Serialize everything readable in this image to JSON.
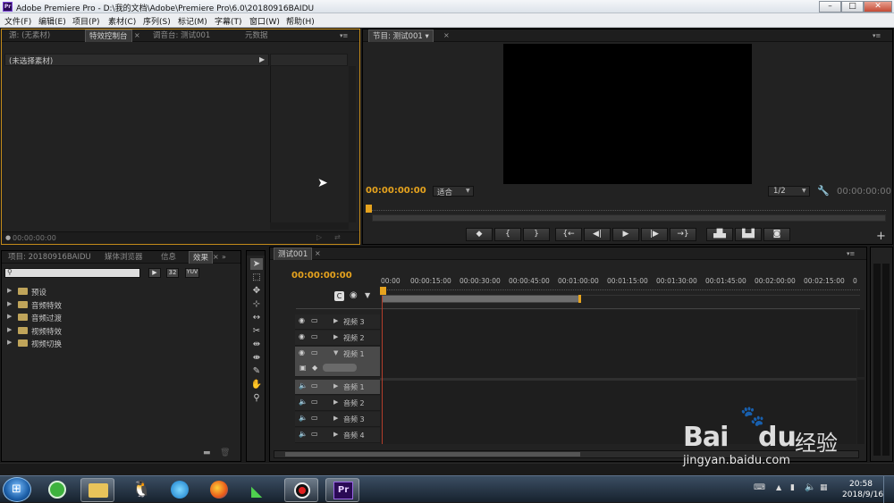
{
  "app": {
    "title": "Adobe Premiere Pro - D:\\我的文档\\Adobe\\Premiere Pro\\6.0\\20180916BAIDU",
    "logo": "Pr"
  },
  "menu": [
    "文件(F)",
    "编辑(E)",
    "项目(P)",
    "素材(C)",
    "序列(S)",
    "标记(M)",
    "字幕(T)",
    "窗口(W)",
    "帮助(H)"
  ],
  "source_panel": {
    "tabs": [
      "源: (无素材)",
      "特效控制台",
      "调音台: 测试001",
      "元数据"
    ],
    "no_clip": "(未选择素材)",
    "footer_tc": "00:00:00:00"
  },
  "program": {
    "tab": "节目: 测试001",
    "timecode": "00:00:00:00",
    "fit": "适合",
    "quality": "1/2",
    "duration": "00:00:00:00"
  },
  "project_panel": {
    "tabs": [
      "项目: 20180916BAIDU",
      "媒体浏览器",
      "信息",
      "效果"
    ],
    "icon_labels": [
      "32",
      "YUV"
    ],
    "items": [
      "预设",
      "音频特效",
      "音频过渡",
      "视频特效",
      "视频切换"
    ]
  },
  "timeline": {
    "tab": "测试001",
    "timecode": "00:00:00:00",
    "ruler": [
      "00:00",
      "00:00:15:00",
      "00:00:30:00",
      "00:00:45:00",
      "00:01:00:00",
      "00:01:15:00",
      "00:01:30:00",
      "00:01:45:00",
      "00:02:00:00",
      "00:02:15:00",
      "0"
    ],
    "video_tracks": [
      "视频 3",
      "视频 2",
      "视频 1"
    ],
    "audio_tracks": [
      "音频 1",
      "音频 2",
      "音频 3",
      "音频 4"
    ]
  },
  "taskbar": {
    "time": "20:58",
    "date": "2018/9/16",
    "pr_label": "Pr"
  },
  "watermark": {
    "site": "jingyan.baidu.com",
    "brand": "Bai",
    "brand2": "du",
    "cn": "经验"
  },
  "colors": {
    "accent": "#e6a31e",
    "panel_active_border": "#c48b1a",
    "playhead": "#b33d2a"
  }
}
